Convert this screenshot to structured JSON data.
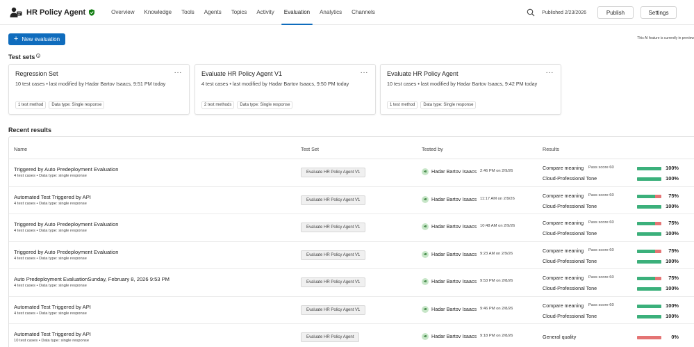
{
  "app": {
    "title": "HR Policy Agent",
    "agent_icon": "agent-people-icon",
    "verified_icon": "shield-check-icon"
  },
  "nav": {
    "items": [
      {
        "label": "Overview",
        "active": false
      },
      {
        "label": "Knowledge",
        "active": false
      },
      {
        "label": "Tools",
        "active": false
      },
      {
        "label": "Agents",
        "active": false
      },
      {
        "label": "Topics",
        "active": false
      },
      {
        "label": "Activity",
        "active": false
      },
      {
        "label": "Evaluation",
        "active": true
      },
      {
        "label": "Analytics",
        "active": false
      },
      {
        "label": "Channels",
        "active": false
      }
    ]
  },
  "header": {
    "published": "Published 2/23/2026",
    "publish_label": "Publish",
    "settings_label": "Settings"
  },
  "toolbar": {
    "new_eval_label": "New evaluation",
    "preview_note": "This AI feature is currently in preview"
  },
  "test_sets": {
    "title": "Test sets",
    "cards": [
      {
        "title": "Regression Set",
        "sub": "10 test cases • last modified by Hadar Bartov Isaacs, 9:51 PM today",
        "methods": "1 test method",
        "data_type": "Data type: Single response"
      },
      {
        "title": "Evaluate HR Policy Agent V1",
        "sub": "4 test cases • last modified by Hadar Bartov Isaacs, 9:50 PM today",
        "methods": "2 test methods",
        "data_type": "Data type: Single response"
      },
      {
        "title": "Evaluate HR Policy Agent",
        "sub": "10 test cases • last modified by Hadar Bartov Isaacs, 9:42 PM today",
        "methods": "1 test method",
        "data_type": "Data type: Single response"
      }
    ]
  },
  "recent": {
    "title": "Recent results",
    "columns": [
      "Name",
      "Test Set",
      "Tested by",
      "Results"
    ],
    "rows": [
      {
        "name": "Triggered by Auto Predeployment Evaluation",
        "sub": "4 test cases • Data type: single response",
        "set": "Evaluate HR Policy Agent V1",
        "initials": "HI",
        "tester": "Hadar Bartov Isaacs",
        "when": "2:46 PM on 2/9/26",
        "metrics": [
          {
            "name": "Compare meaning",
            "pass": "Pass score 60",
            "pct": "100%",
            "value": 1.0
          },
          {
            "name": "Cloud-Professional Tone",
            "pass": "",
            "pct": "100%",
            "value": 1.0
          }
        ]
      },
      {
        "name": "Automated Test Triggered by API",
        "sub": "4 test cases • Data type: single response",
        "set": "Evaluate HR Policy Agent V1",
        "initials": "HI",
        "tester": "Hadar Bartov Isaacs",
        "when": "11:17 AM on 2/9/26",
        "metrics": [
          {
            "name": "Compare meaning",
            "pass": "Pass score 60",
            "pct": "75%",
            "value": 0.75
          },
          {
            "name": "Cloud-Professional Tone",
            "pass": "",
            "pct": "100%",
            "value": 1.0
          }
        ]
      },
      {
        "name": "Triggered by Auto Predeployment Evaluation",
        "sub": "4 test cases • Data type: single response",
        "set": "Evaluate HR Policy Agent V1",
        "initials": "HI",
        "tester": "Hadar Bartov Isaacs",
        "when": "10:48 AM on 2/9/26",
        "metrics": [
          {
            "name": "Compare meaning",
            "pass": "Pass score 60",
            "pct": "75%",
            "value": 0.75
          },
          {
            "name": "Cloud-Professional Tone",
            "pass": "",
            "pct": "100%",
            "value": 1.0
          }
        ]
      },
      {
        "name": "Triggered by Auto Predeployment Evaluation",
        "sub": "4 test cases • Data type: single response",
        "set": "Evaluate HR Policy Agent V1",
        "initials": "HI",
        "tester": "Hadar Bartov Isaacs",
        "when": "9:23 AM on 2/9/26",
        "metrics": [
          {
            "name": "Compare meaning",
            "pass": "Pass score 60",
            "pct": "75%",
            "value": 0.75
          },
          {
            "name": "Cloud-Professional Tone",
            "pass": "",
            "pct": "100%",
            "value": 1.0
          }
        ]
      },
      {
        "name": "Auto Predeployment EvaluationSunday, February 8, 2026 9:53 PM",
        "sub": "4 test cases • Data type: single response",
        "set": "Evaluate HR Policy Agent V1",
        "initials": "HI",
        "tester": "Hadar Bartov Isaacs",
        "when": "9:53 PM on 2/8/26",
        "metrics": [
          {
            "name": "Compare meaning",
            "pass": "Pass score 60",
            "pct": "75%",
            "value": 0.75
          },
          {
            "name": "Cloud-Professional Tone",
            "pass": "",
            "pct": "100%",
            "value": 1.0
          }
        ]
      },
      {
        "name": "Automated Test Triggered by API",
        "sub": "4 test cases • Data type: single response",
        "set": "Evaluate HR Policy Agent V1",
        "initials": "HI",
        "tester": "Hadar Bartov Isaacs",
        "when": "9:46 PM on 2/8/26",
        "metrics": [
          {
            "name": "Compare meaning",
            "pass": "Pass score 60",
            "pct": "100%",
            "value": 1.0
          },
          {
            "name": "Cloud-Professional Tone",
            "pass": "",
            "pct": "100%",
            "value": 1.0
          }
        ]
      },
      {
        "name": "Automated Test Triggered by API",
        "sub": "10 test cases • Data type: single response",
        "set": "Evaluate HR Policy Agent",
        "initials": "HI",
        "tester": "Hadar Bartov Isaacs",
        "when": "9:18 PM on 2/8/26",
        "metrics": [
          {
            "name": "General quality",
            "pass": "",
            "pct": "0%",
            "value": 0.0
          }
        ]
      }
    ]
  },
  "colors": {
    "accent": "#0f6cbd",
    "pass": "#3bb07b",
    "fail": "#e47474",
    "avatar_bg": "#c7e6c8"
  }
}
